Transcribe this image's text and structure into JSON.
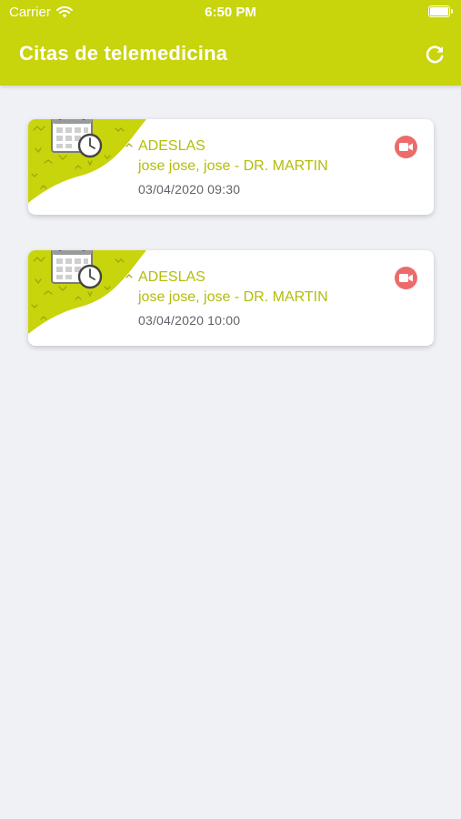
{
  "status_bar": {
    "carrier": "Carrier",
    "time": "6:50 PM"
  },
  "header": {
    "title": "Citas de telemedicina",
    "action_icon": "refresh-icon"
  },
  "colors": {
    "primary": "#c8d40c",
    "text_accent": "#b3bd08",
    "video_button": "#ec6b6b",
    "background": "#eff1f5"
  },
  "appointments": [
    {
      "company": "ADESLAS",
      "patient_doctor": "jose jose, jose - DR. MARTIN",
      "datetime": "03/04/2020 09:30",
      "icon": "video-camera-icon"
    },
    {
      "company": "ADESLAS",
      "patient_doctor": "jose jose, jose - DR. MARTIN",
      "datetime": "03/04/2020 10:00",
      "icon": "video-camera-icon"
    }
  ]
}
